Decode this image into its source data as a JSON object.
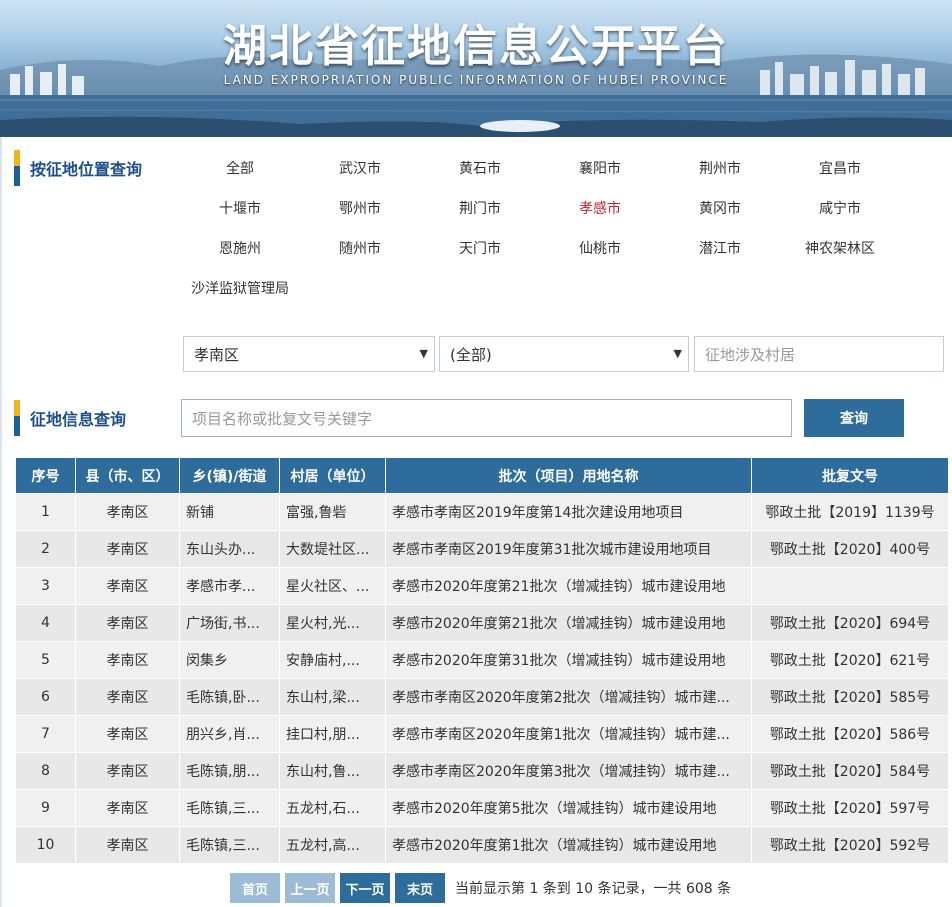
{
  "banner": {
    "title": "湖北省征地信息公开平台",
    "subtitle": "LAND  EXPROPRIATION  PUBLIC  INFORMATION  OF  HUBEI  PROVINCE"
  },
  "location_section": {
    "label": "按征地位置查询",
    "regions": [
      {
        "label": "全部",
        "active": false
      },
      {
        "label": "武汉市",
        "active": false
      },
      {
        "label": "黄石市",
        "active": false
      },
      {
        "label": "襄阳市",
        "active": false
      },
      {
        "label": "荆州市",
        "active": false
      },
      {
        "label": "宜昌市",
        "active": false
      },
      {
        "label": "十堰市",
        "active": false
      },
      {
        "label": "鄂州市",
        "active": false
      },
      {
        "label": "荆门市",
        "active": false
      },
      {
        "label": "孝感市",
        "active": true
      },
      {
        "label": "黄冈市",
        "active": false
      },
      {
        "label": "咸宁市",
        "active": false
      },
      {
        "label": "恩施州",
        "active": false
      },
      {
        "label": "随州市",
        "active": false
      },
      {
        "label": "天门市",
        "active": false
      },
      {
        "label": "仙桃市",
        "active": false
      },
      {
        "label": "潜江市",
        "active": false
      },
      {
        "label": "神农架林区",
        "active": false
      },
      {
        "label": "沙洋监狱管理局",
        "active": false
      }
    ],
    "county_select": "孝南区",
    "town_select": "(全部)",
    "village_placeholder": "征地涉及村居"
  },
  "info_section": {
    "label": "征地信息查询",
    "keyword_placeholder": "项目名称或批复文号关键字",
    "search_button": "查询"
  },
  "colors": {
    "header_blue": "#2d6c9b",
    "active_red": "#c0282d",
    "title_blue": "#1c4f85",
    "accent_yellow": "#f2b51d"
  },
  "table": {
    "headers": [
      "序号",
      "县（市、区）",
      "乡(镇)/街道",
      "村居（单位）",
      "批次（项目）用地名称",
      "批复文号"
    ],
    "rows": [
      [
        "1",
        "孝南区",
        "新铺",
        "富强,鲁砦",
        "孝感市孝南区2019年度第14批次建设用地项目",
        "鄂政土批【2019】1139号"
      ],
      [
        "2",
        "孝南区",
        "东山头办...",
        "大数堤社区...",
        "孝感市孝南区2019年度第31批次城市建设用地项目",
        "鄂政土批【2020】400号"
      ],
      [
        "3",
        "孝南区",
        "孝感市孝...",
        "星火社区、...",
        "孝感市2020年度第21批次（增减挂钩）城市建设用地",
        ""
      ],
      [
        "4",
        "孝南区",
        "广场街,书...",
        "星火村,光...",
        "孝感市2020年度第21批次（增减挂钩）城市建设用地",
        "鄂政土批【2020】694号"
      ],
      [
        "5",
        "孝南区",
        "闵集乡",
        "安静庙村,...",
        "孝感市2020年度第31批次（增减挂钩）城市建设用地",
        "鄂政土批【2020】621号"
      ],
      [
        "6",
        "孝南区",
        "毛陈镇,卧...",
        "东山村,梁...",
        "孝感市孝南区2020年度第2批次（增减挂钩）城市建...",
        "鄂政土批【2020】585号"
      ],
      [
        "7",
        "孝南区",
        "朋兴乡,肖...",
        "挂口村,朋...",
        "孝感市孝南区2020年度第1批次（增减挂钩）城市建...",
        "鄂政土批【2020】586号"
      ],
      [
        "8",
        "孝南区",
        "毛陈镇,朋...",
        "东山村,鲁...",
        "孝感市孝南区2020年度第3批次（增减挂钩）城市建...",
        "鄂政土批【2020】584号"
      ],
      [
        "9",
        "孝南区",
        "毛陈镇,三...",
        "五龙村,石...",
        "孝感市2020年度第5批次（增减挂钩）城市建设用地",
        "鄂政土批【2020】597号"
      ],
      [
        "10",
        "孝南区",
        "毛陈镇,三...",
        "五龙村,高...",
        "孝感市2020年度第1批次（增减挂钩）城市建设用地",
        "鄂政土批【2020】592号"
      ]
    ]
  },
  "pager": {
    "first": "首页",
    "prev": "上一页",
    "next": "下一页",
    "last": "末页",
    "info": "当前显示第 1 条到 10 条记录，一共 608 条"
  }
}
